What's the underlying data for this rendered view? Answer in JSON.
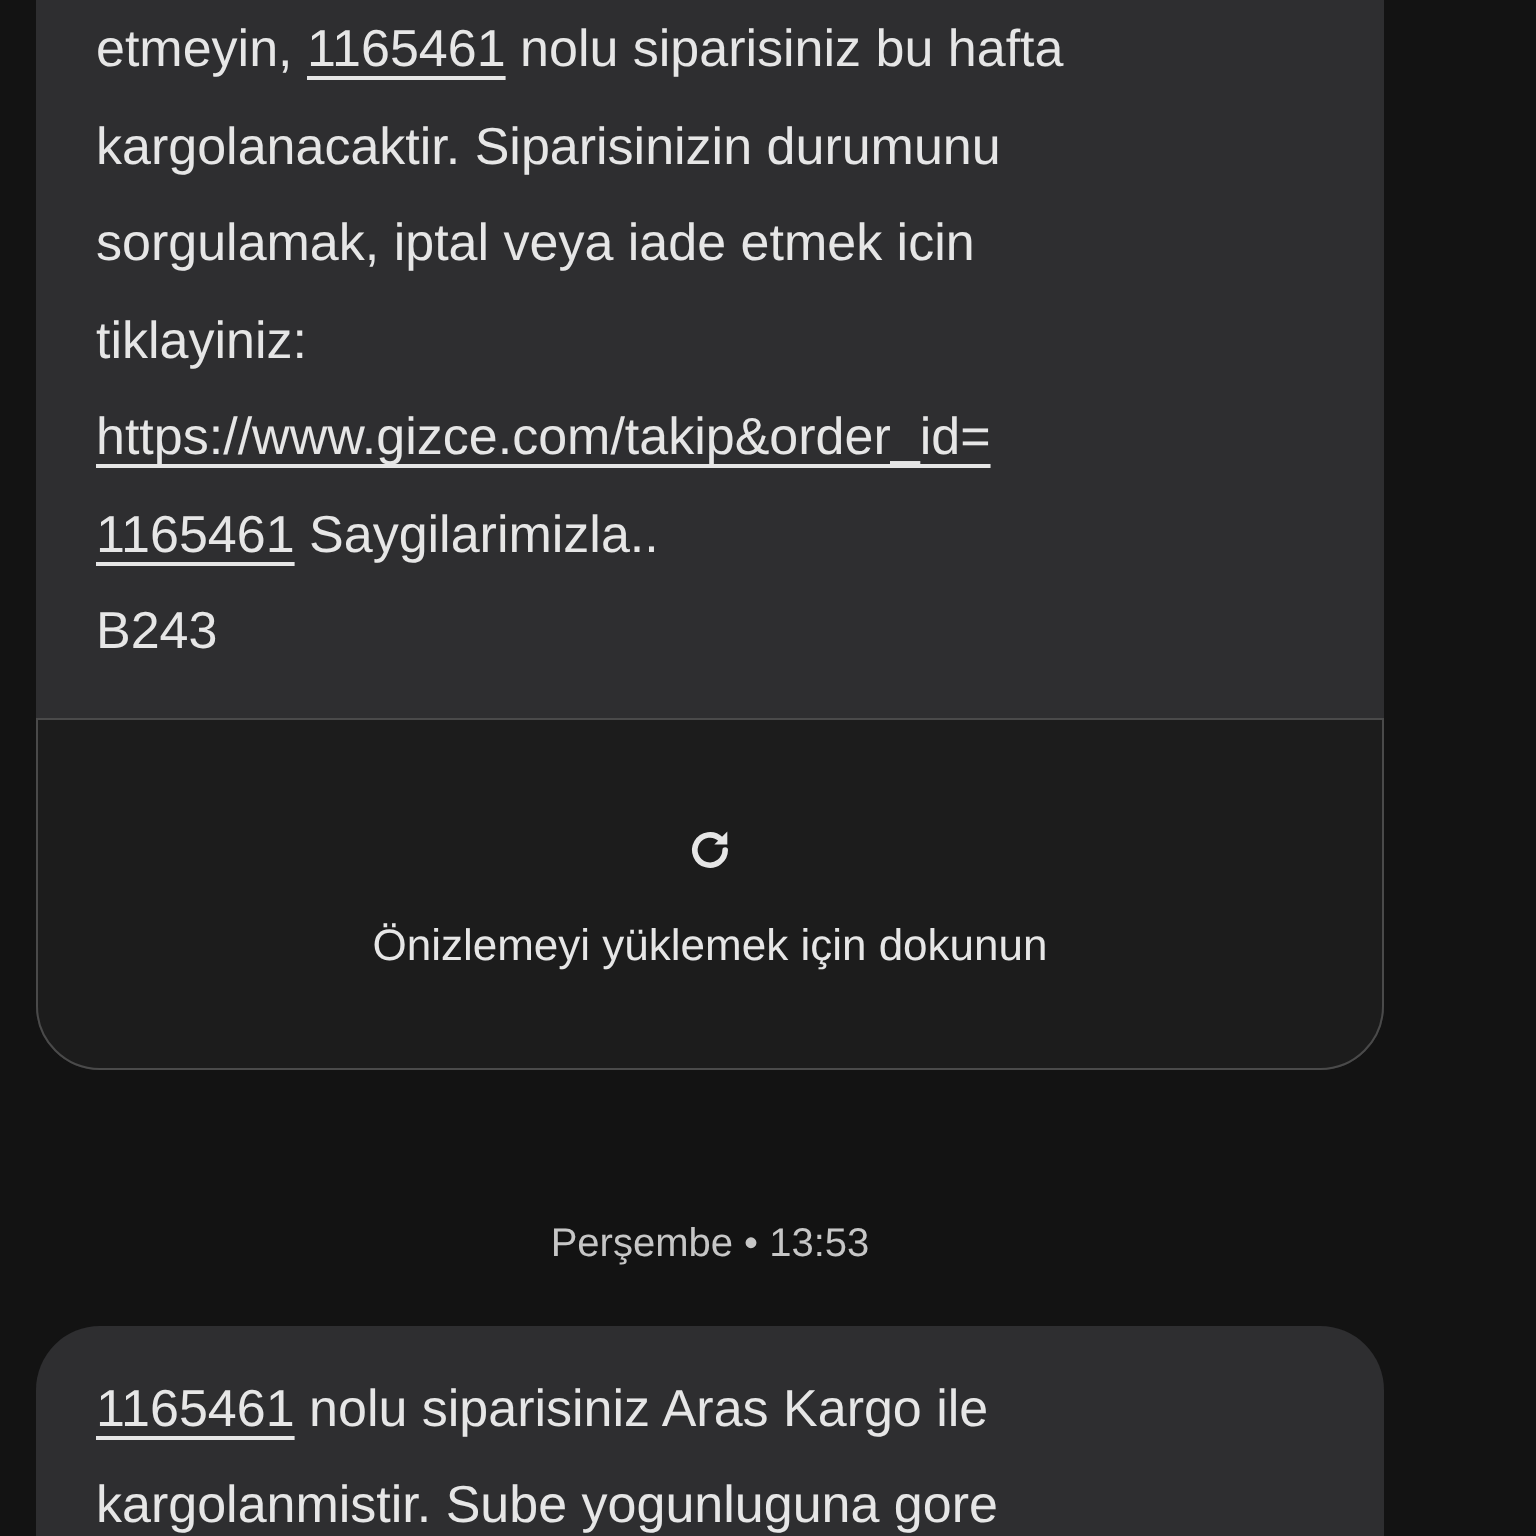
{
  "messages": [
    {
      "lines": [
        [
          {
            "kind": "plain",
            "text": "etmeyin, "
          },
          {
            "kind": "link",
            "text": "1165461"
          },
          {
            "kind": "plain",
            "text": " nolu siparisiniz bu hafta"
          }
        ],
        [
          {
            "kind": "plain",
            "text": "kargolanacaktir. Siparisinizin durumunu"
          }
        ],
        [
          {
            "kind": "plain",
            "text": "sorgulamak, iptal veya iade etmek icin"
          }
        ],
        [
          {
            "kind": "plain",
            "text": "tiklayiniz:"
          }
        ],
        [
          {
            "kind": "link",
            "text": "https://www.gizce.com/takip&order_id="
          }
        ],
        [
          {
            "kind": "link",
            "text": "1165461"
          },
          {
            "kind": "plain",
            "text": " Saygilarimizla.."
          }
        ],
        [
          {
            "kind": "plain",
            "text": "B243"
          }
        ]
      ],
      "preview": {
        "label": "Önizlemeyi yüklemek için dokunun"
      }
    },
    {
      "timestamp": "Perşembe • 13:53",
      "lines": [
        [
          {
            "kind": "link",
            "text": "1165461"
          },
          {
            "kind": "plain",
            "text": " nolu siparisiniz Aras Kargo ile"
          }
        ],
        [
          {
            "kind": "plain",
            "text": "kargolanmistir. Sube yogunluguna gore"
          }
        ]
      ]
    }
  ]
}
